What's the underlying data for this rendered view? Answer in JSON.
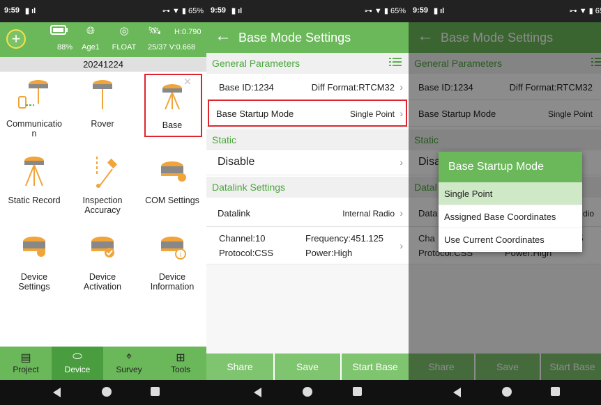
{
  "status": {
    "time": "9:59",
    "battery": "65%",
    "battery_cut": "65"
  },
  "p1": {
    "battery_pct": "88%",
    "age": "Age1",
    "fix": "FLOAT",
    "sats": "25/37",
    "h": "H:0.790",
    "v": "V:0.668",
    "date": "20241224",
    "items": [
      {
        "label": "Communicatio",
        "label2": "n",
        "icon": "communication-icon"
      },
      {
        "label": "Rover",
        "label2": "",
        "icon": "rover-icon"
      },
      {
        "label": "Base",
        "label2": "",
        "icon": "base-icon"
      },
      {
        "label": "Static Record",
        "label2": "",
        "icon": "static-record-icon"
      },
      {
        "label": "Inspection",
        "label2": "Accuracy",
        "icon": "inspection-accuracy-icon"
      },
      {
        "label": "COM Settings",
        "label2": "",
        "icon": "com-settings-icon"
      },
      {
        "label": "Device",
        "label2": "Settings",
        "icon": "device-settings-icon"
      },
      {
        "label": "Device",
        "label2": "Activation",
        "icon": "device-activation-icon"
      },
      {
        "label": "Device",
        "label2": "Information",
        "icon": "device-information-icon"
      }
    ],
    "tabs": [
      {
        "label": "Project",
        "icon": "project-icon"
      },
      {
        "label": "Device",
        "icon": "device-icon"
      },
      {
        "label": "Survey",
        "icon": "survey-icon"
      },
      {
        "label": "Tools",
        "icon": "tools-icon"
      }
    ]
  },
  "p2": {
    "title": "Base Mode Settings",
    "general": "General Parameters",
    "base_id": "Base ID:1234",
    "diff_format": "Diff Format:RTCM32",
    "startup_label": "Base Startup Mode",
    "startup_value": "Single Point",
    "static": "Static",
    "static_value": "Disable",
    "datalink_settings": "Datalink Settings",
    "datalink_label": "Datalink",
    "datalink_value": "Internal Radio",
    "channel": "Channel:10",
    "frequency": "Frequency:451.125",
    "protocol": "Protocol:CSS",
    "power": "Power:High",
    "buttons": {
      "share": "Share",
      "save": "Save",
      "start": "Start Base"
    }
  },
  "p3": {
    "title": "Base Mode Settings",
    "general": "General Parameters",
    "base_id": "Base ID:1234",
    "diff_format": "Diff Format:RTCM32",
    "startup_label": "Base Startup Mode",
    "startup_value": "Single Point",
    "static": "Static",
    "static_partial": "Disa",
    "datalink_partial": "Datal",
    "datalink_partial2": "Data",
    "datalink_value_partial": "dio",
    "channel_partial": "Cha",
    "freq_partial": "25",
    "protocol": "Protocol:CSS",
    "power": "Power:High",
    "dialog": {
      "title": "Base Startup Mode",
      "options": [
        "Single Point",
        "Assigned Base Coordinates",
        "Use Current Coordinates"
      ]
    },
    "buttons": {
      "share": "Share",
      "save": "Save",
      "start": "Start Base"
    }
  }
}
